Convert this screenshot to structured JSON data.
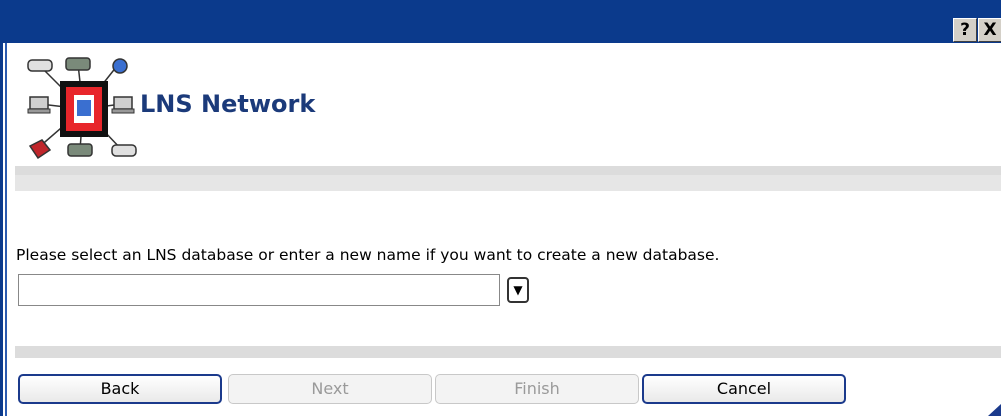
{
  "titlebar": {
    "help_label": "?",
    "close_label": "X"
  },
  "header": {
    "title": "LNS Network",
    "logo_icon": "network-devices-icon"
  },
  "main": {
    "prompt": "Please select an LNS database or enter a new name if you want to create a new database.",
    "database_combo": {
      "value": "",
      "placeholder": ""
    },
    "dropdown_glyph": "▼"
  },
  "buttons": {
    "back": "Back",
    "next": "Next",
    "finish": "Finish",
    "cancel": "Cancel"
  },
  "colors": {
    "titlebar": "#0b3a8c",
    "title_text": "#1b3a7a"
  }
}
